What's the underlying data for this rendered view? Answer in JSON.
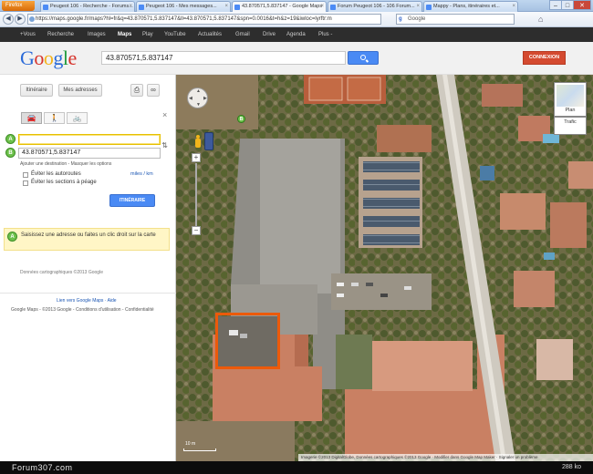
{
  "browser": {
    "menu_button": "Firefox",
    "tabs": [
      {
        "title": "Peugeot 106 - Recherche - Forums..."
      },
      {
        "title": "Peugeot 106 - Mes messages..."
      },
      {
        "title": "43.870571,5.837147 - Google Maps"
      },
      {
        "title": "Forum Peugeot 106 - 106 Forum..."
      },
      {
        "title": "Mappy - Plans, itinéraires et..."
      }
    ],
    "url": "https://maps.google.fr/maps?hl=fr&q=43.870571,5.837147&ll=43.870571,5.837147&spn=0.0016&t=h&z=19&iwloc=lyrftr:m",
    "search_engine": "Google",
    "window_controls": [
      "–",
      "□",
      "✕"
    ]
  },
  "gbar": {
    "items": [
      "+Vous",
      "Recherche",
      "Images",
      "Maps",
      "Play",
      "YouTube",
      "Actualités",
      "Gmail",
      "Drive",
      "Agenda",
      "Plus -"
    ],
    "active_index": 3
  },
  "header": {
    "logo_letters": [
      "G",
      "o",
      "o",
      "g",
      "l",
      "e"
    ],
    "search_value": "43.870571,5.837147",
    "signin_label": "CONNEXION"
  },
  "panel": {
    "directions_label": "Itinéraire",
    "my_places_label": "Mes adresses",
    "print_icon": "print-icon",
    "link_icon": "link-icon",
    "modes": [
      {
        "icon": "car-icon",
        "glyph": "🚘"
      },
      {
        "icon": "walk-icon",
        "glyph": "🚶"
      },
      {
        "icon": "bike-icon",
        "glyph": "🚲"
      }
    ],
    "route_a": {
      "label": "A",
      "value": ""
    },
    "route_b": {
      "label": "B",
      "value": "43.870571,5.837147"
    },
    "add_destination": "Ajouter une destination - Masquer les options",
    "avoid_highways": "Éviter les autoroutes",
    "avoid_tolls": "Éviter les sections à péage",
    "units": "miles / km",
    "route_button": "ITINÉRAIRE",
    "notice_marker": "A",
    "notice_text": "Saisissez une adresse ou faites un clic droit sur la carte",
    "map_data_credit": "Données cartographiques ©2013 Google",
    "footer_links": "Lien vers Google Maps · Aide",
    "footer_legal": "Google Maps - ©2013 Google - Conditions d'utilisation - Confidentialité"
  },
  "map": {
    "marker_b": "B",
    "layer_plan": "Plan",
    "layer_traffic": "Trafic",
    "scale_label": "10 m",
    "copyright": "Imagerie ©2013 DigitalGlobe, Données cartographiques ©2013 Google · Modifier dans Google Map Maker · Signaler un problème",
    "highlight_color": "#ec5a0a"
  },
  "status": {
    "watermark": "Forum307.com",
    "filesize": "288 ko"
  }
}
